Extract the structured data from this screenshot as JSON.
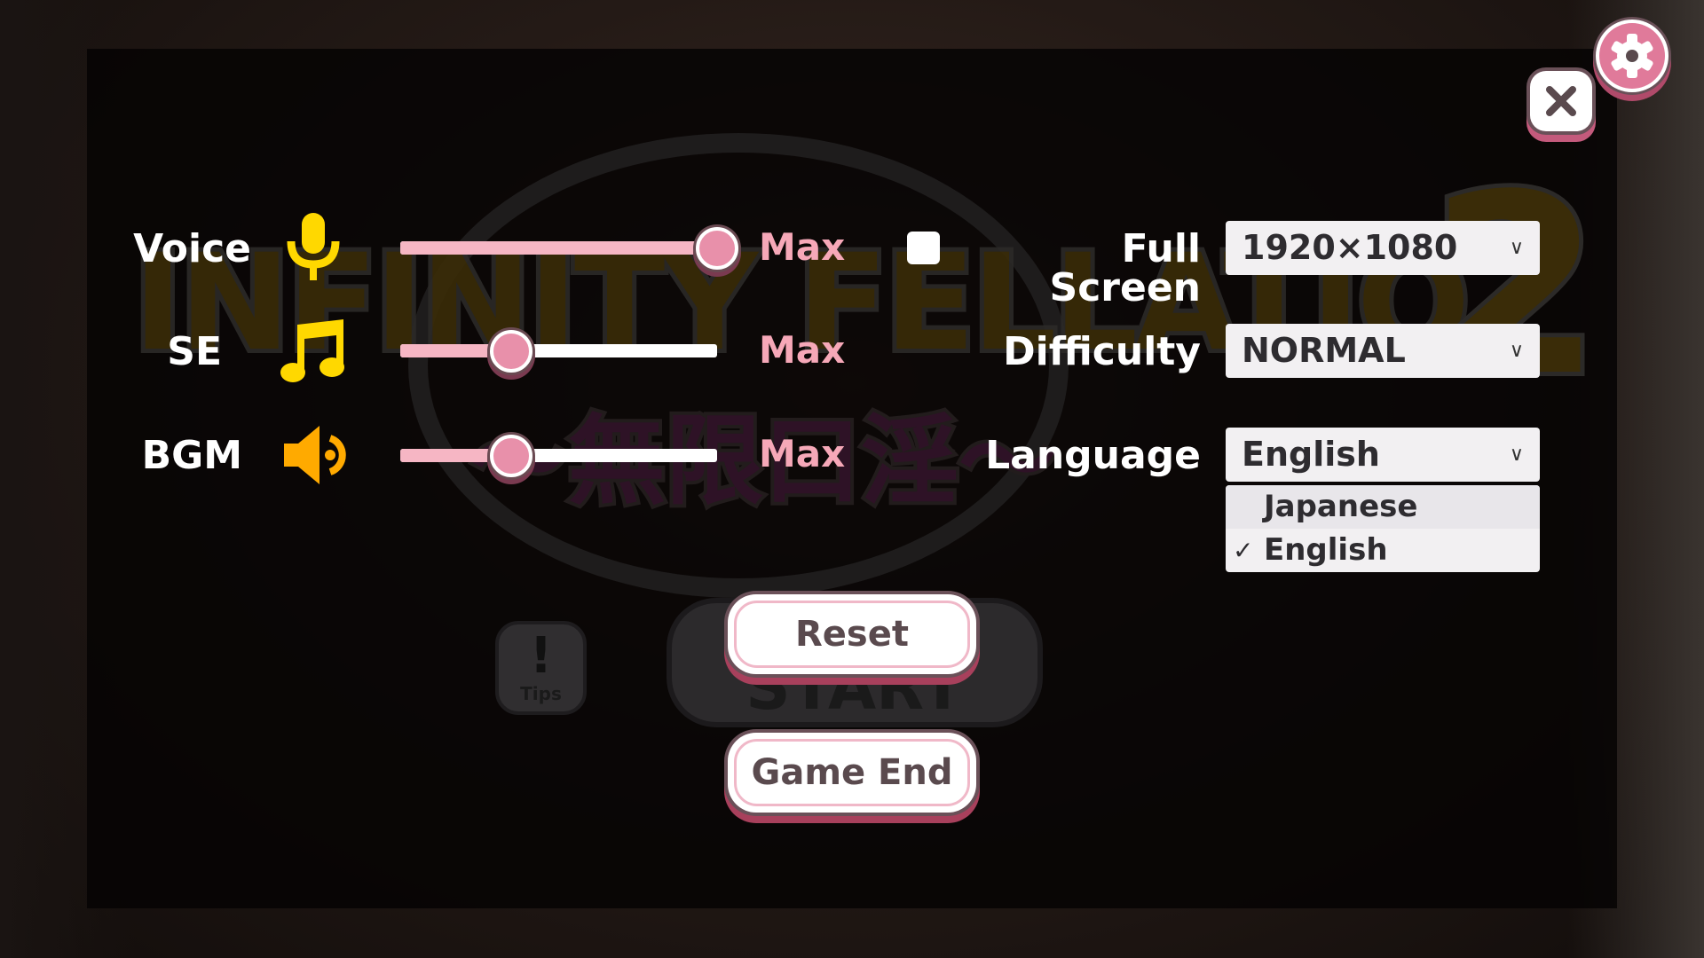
{
  "background_logo": {
    "title": "INFINITY FELLATIO",
    "number": "2",
    "subtitle": "～無限口淫～"
  },
  "audio": [
    {
      "label": "Voice",
      "icon": "microphone-icon",
      "value_percent": 100,
      "value_label": "Max"
    },
    {
      "label": "SE",
      "icon": "music-note-icon",
      "value_percent": 35,
      "value_label": "Max"
    },
    {
      "label": "BGM",
      "icon": "speaker-icon",
      "value_percent": 35,
      "value_label": "Max"
    }
  ],
  "display": {
    "fullscreen_label": "Full Screen",
    "fullscreen_checked": false,
    "resolution": "1920×1080",
    "difficulty_label": "Difficulty",
    "difficulty": "NORMAL",
    "language_label": "Language",
    "language": "English",
    "language_options": [
      {
        "label": "Japanese",
        "selected": false
      },
      {
        "label": "English",
        "selected": true
      }
    ],
    "check_glyph": "✓",
    "chevron": "∨"
  },
  "buttons": {
    "reset": "Reset",
    "game_end": "Game End",
    "start": "START",
    "tips": "Tips",
    "tips_glyph": "!"
  },
  "colors": {
    "accent_pink": "#e890aa",
    "max_text": "#f6a8b8",
    "icon_yellow": "#ffd800",
    "icon_orange": "#ffaa00",
    "button_text": "#5a4a4e"
  }
}
